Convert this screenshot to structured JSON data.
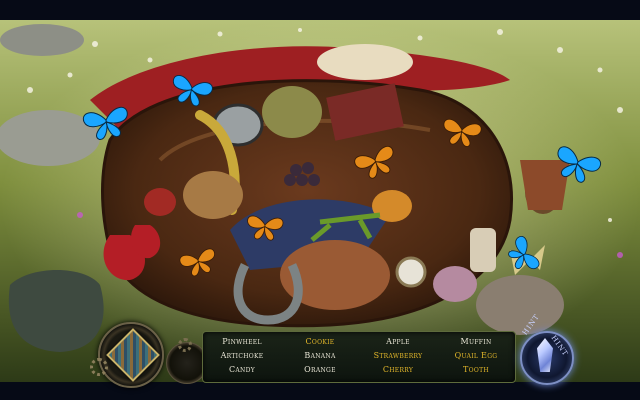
{
  "scene": {
    "name": "picnic-basket-hidden-object-scene",
    "icons": [
      "butterfly-icon",
      "horseshoe-icon",
      "pocket-watch-icon",
      "pinecone-icon",
      "grasshopper-icon",
      "pinwheel-icon"
    ]
  },
  "hud": {
    "diary_icon": "diary-book-icon",
    "hint": {
      "label_left": "HINT",
      "label_right": "HINT",
      "icon": "crystal-icon"
    },
    "items": [
      {
        "label": "Pinwheel",
        "found": false
      },
      {
        "label": "Cookie",
        "found": true
      },
      {
        "label": "Apple",
        "found": false
      },
      {
        "label": "Muffin",
        "found": false
      },
      {
        "label": "Artichoke",
        "found": false
      },
      {
        "label": "Banana",
        "found": false
      },
      {
        "label": "Strawberry",
        "found": true
      },
      {
        "label": "Quail Egg",
        "found": true
      },
      {
        "label": "Candy",
        "found": false
      },
      {
        "label": "Orange",
        "found": false
      },
      {
        "label": "Cherry",
        "found": true
      },
      {
        "label": "Tooth",
        "found": true
      }
    ]
  },
  "colors": {
    "item_default": "#e9e6d6",
    "item_highlight": "#e3b72a",
    "hint_glow": "#6b87d8",
    "butterfly_blue": "#1aa6ff",
    "butterfly_orange": "#e58a18"
  }
}
